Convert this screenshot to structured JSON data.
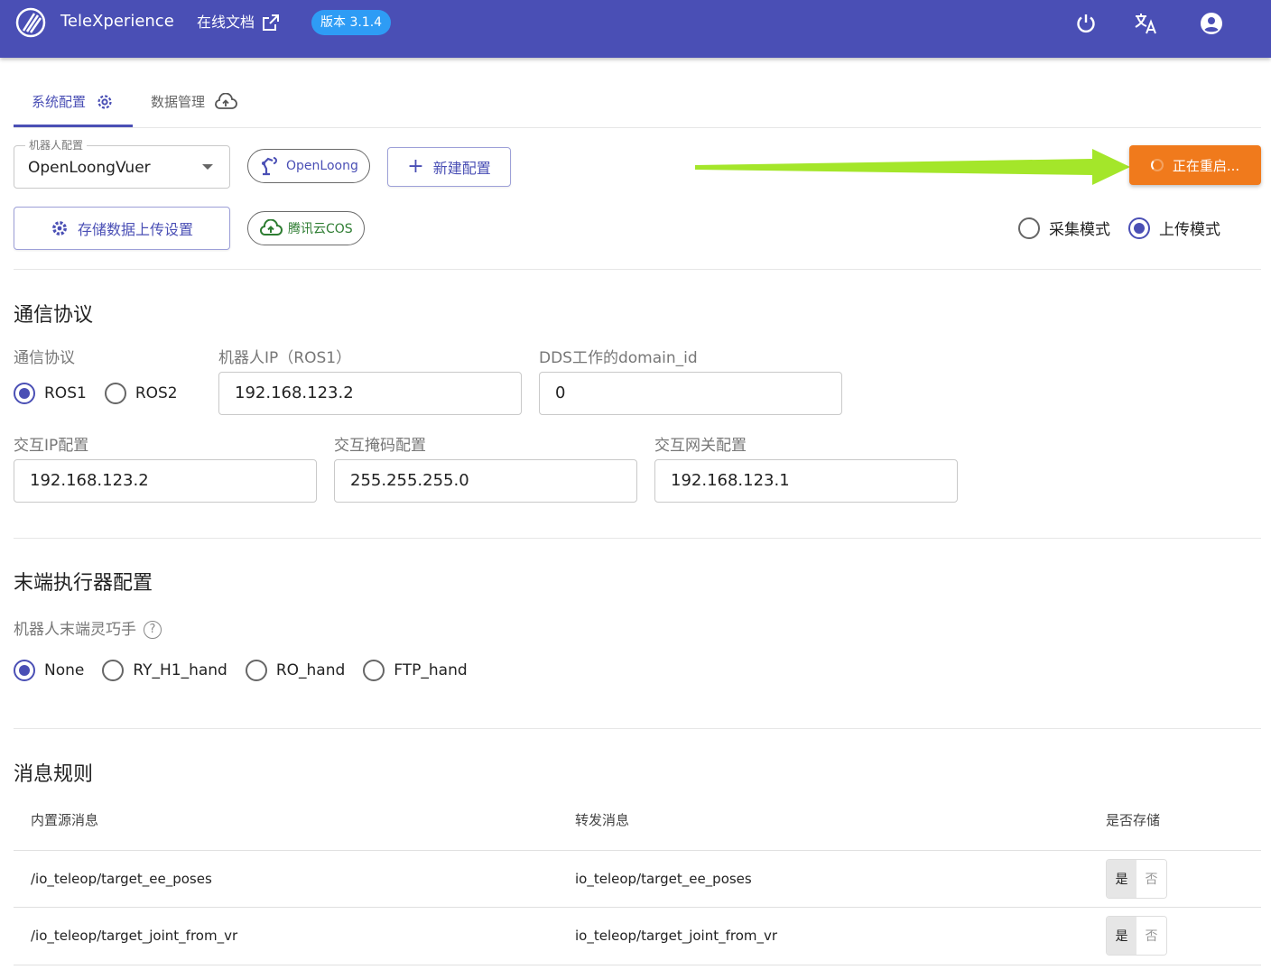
{
  "header": {
    "app_title": "TeleXperience",
    "docs_label": "在线文档",
    "version_label": "版本 3.1.4",
    "icons": [
      "power-icon",
      "translate-icon",
      "account-icon"
    ]
  },
  "tabs": [
    {
      "label": "系统配置",
      "icon": "gear-icon",
      "active": true
    },
    {
      "label": "数据管理",
      "icon": "cloud-upload-icon",
      "active": false
    }
  ],
  "robot_config": {
    "label": "机器人配置",
    "selected": "OpenLoongVuer",
    "chip_label": "OpenLoong",
    "new_config_label": "新建配置",
    "storage_upload_label": "存储数据上传设置",
    "cloud_chip_label": "腾讯云COS",
    "restart_label": "正在重启..."
  },
  "mode": {
    "options": [
      {
        "label": "采集模式",
        "checked": false
      },
      {
        "label": "上传模式",
        "checked": true
      }
    ]
  },
  "comm": {
    "section_title": "通信协议",
    "protocol_label": "通信协议",
    "protocols": [
      {
        "label": "ROS1",
        "checked": true
      },
      {
        "label": "ROS2",
        "checked": false
      }
    ],
    "robot_ip_label": "机器人IP（ROS1）",
    "robot_ip_value": "192.168.123.2",
    "dds_label": "DDS工作的domain_id",
    "dds_value": "0",
    "ip_label": "交互IP配置",
    "ip_value": "192.168.123.2",
    "mask_label": "交互掩码配置",
    "mask_value": "255.255.255.0",
    "gateway_label": "交互网关配置",
    "gateway_value": "192.168.123.1"
  },
  "effector": {
    "section_title": "末端执行器配置",
    "hand_label": "机器人末端灵巧手",
    "help_glyph": "?",
    "options": [
      {
        "label": "None",
        "checked": true
      },
      {
        "label": "RY_H1_hand",
        "checked": false
      },
      {
        "label": "RO_hand",
        "checked": false
      },
      {
        "label": "FTP_hand",
        "checked": false
      }
    ]
  },
  "rules": {
    "section_title": "消息规则",
    "headers": [
      "内置源消息",
      "转发消息",
      "是否存储"
    ],
    "rows": [
      {
        "source": "/io_teleop/target_ee_poses",
        "forward": "io_teleop/target_ee_poses",
        "yes": "是",
        "no": "否"
      },
      {
        "source": "/io_teleop/target_joint_from_vr",
        "forward": "io_teleop/target_joint_from_vr",
        "yes": "是",
        "no": "否"
      }
    ]
  },
  "colors": {
    "primary": "#4a4fb5",
    "restart": "#f07a1c",
    "annotation_arrow": "#a4e62a",
    "version_badge": "#2e9cf5"
  }
}
